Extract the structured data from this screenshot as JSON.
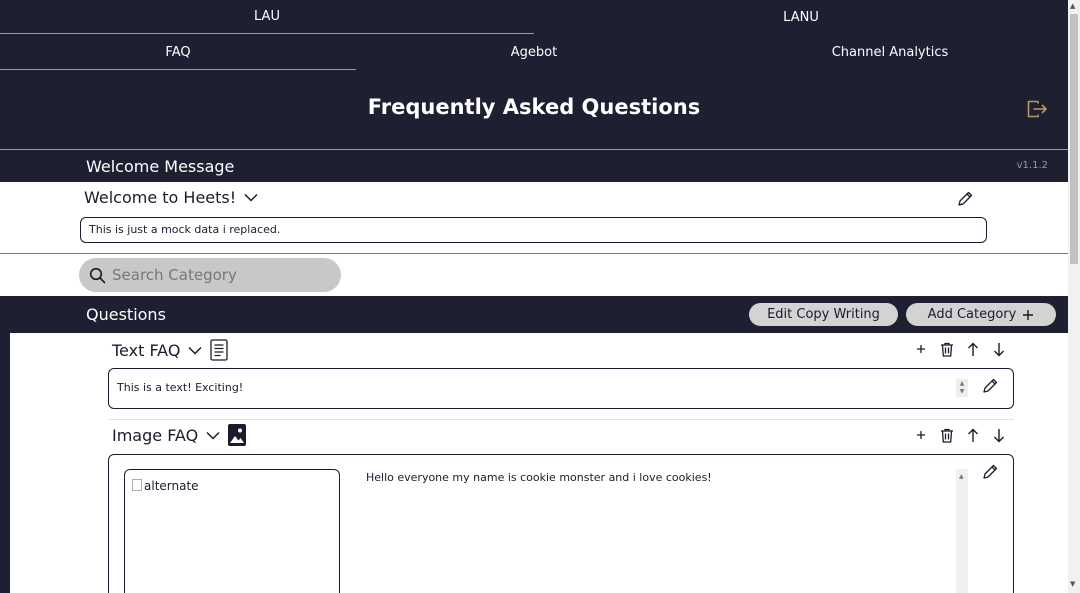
{
  "nav": {
    "top_tabs": [
      "LAU",
      "LANU"
    ],
    "sub_tabs": [
      "FAQ",
      "Agebot",
      "Channel Analytics"
    ]
  },
  "page_title": "Frequently Asked Questions",
  "welcome": {
    "section_label": "Welcome Message",
    "version": "v1.1.2",
    "title": "Welcome to Heets!",
    "message": "This is just a mock data i replaced."
  },
  "search": {
    "placeholder": "Search Category"
  },
  "questions": {
    "label": "Questions",
    "edit_copy_label": "Edit Copy Writing",
    "add_category_label": "Add Category"
  },
  "faqs": [
    {
      "title": "Text FAQ",
      "type": "text",
      "content": "This is a text! Exciting!"
    },
    {
      "title": "Image FAQ",
      "type": "image",
      "image_alt": "alternate",
      "content": "Hello everyone my name is cookie monster and i love cookies!"
    }
  ],
  "icons": {
    "logout": "logout-icon",
    "edit": "pencil-icon",
    "search": "search-icon",
    "chevron": "chevron-down-icon",
    "add": "plus-icon",
    "delete": "trash-icon",
    "move_up": "arrow-up-icon",
    "move_down": "arrow-down-icon"
  },
  "colors": {
    "header_bg": "#1f1f32",
    "accent_line": "#b69a62",
    "pill_bg": "#d3d3d3",
    "search_bg": "#c8c8c8"
  }
}
